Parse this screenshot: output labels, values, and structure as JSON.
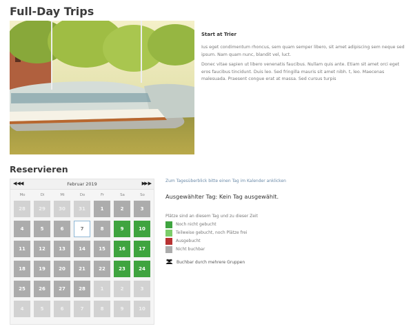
{
  "page": {
    "title": "Full-Day Trips"
  },
  "info": {
    "heading": "Start at Trier",
    "paragraphs": [
      "Ius eget condimentum rhoncus, sem quam semper libero, sit amet adipiscing sem neque sed ipsum. Nam quam nunc, blandit vel, luct.",
      "Donec vitae sapien ut libero venenatis faucibus. Nullam quis ante. Etiam sit amet orci eget eros faucibus tincidunt. Duis leo. Sed fringilla mauris sit amet nibh. t, leo. Maecenas malesuada. Praesent congue erat at massa. Sed cursus turpis"
    ]
  },
  "reserve": {
    "title": "Reservieren"
  },
  "calendar": {
    "month_label": "Februar 2019",
    "nav": {
      "prev_year": "◀◀",
      "prev_month": "◀",
      "next_month": "▶",
      "next_year": "▶▶"
    },
    "weekdays": [
      "Mo",
      "Di",
      "Mi",
      "Do",
      "Fr",
      "Sa",
      "So"
    ],
    "weeks": [
      [
        {
          "d": "28",
          "s": "outside"
        },
        {
          "d": "29",
          "s": "outside"
        },
        {
          "d": "30",
          "s": "outside"
        },
        {
          "d": "31",
          "s": "outside"
        },
        {
          "d": "1",
          "s": "unbookable"
        },
        {
          "d": "2",
          "s": "unbookable"
        },
        {
          "d": "3",
          "s": "unbookable"
        }
      ],
      [
        {
          "d": "4",
          "s": "unbookable"
        },
        {
          "d": "5",
          "s": "unbookable"
        },
        {
          "d": "6",
          "s": "unbookable"
        },
        {
          "d": "7",
          "s": "today"
        },
        {
          "d": "8",
          "s": "unbookable"
        },
        {
          "d": "9",
          "s": "free"
        },
        {
          "d": "10",
          "s": "free"
        }
      ],
      [
        {
          "d": "11",
          "s": "unbookable"
        },
        {
          "d": "12",
          "s": "unbookable"
        },
        {
          "d": "13",
          "s": "unbookable"
        },
        {
          "d": "14",
          "s": "unbookable"
        },
        {
          "d": "15",
          "s": "unbookable"
        },
        {
          "d": "16",
          "s": "free"
        },
        {
          "d": "17",
          "s": "free"
        }
      ],
      [
        {
          "d": "18",
          "s": "unbookable"
        },
        {
          "d": "19",
          "s": "unbookable"
        },
        {
          "d": "20",
          "s": "unbookable"
        },
        {
          "d": "21",
          "s": "unbookable"
        },
        {
          "d": "22",
          "s": "unbookable"
        },
        {
          "d": "23",
          "s": "free"
        },
        {
          "d": "24",
          "s": "free"
        }
      ],
      [
        {
          "d": "25",
          "s": "unbookable"
        },
        {
          "d": "26",
          "s": "unbookable"
        },
        {
          "d": "27",
          "s": "unbookable"
        },
        {
          "d": "28",
          "s": "unbookable"
        },
        {
          "d": "1",
          "s": "outside"
        },
        {
          "d": "2",
          "s": "outside"
        },
        {
          "d": "3",
          "s": "outside"
        }
      ],
      [
        {
          "d": "4",
          "s": "outside"
        },
        {
          "d": "5",
          "s": "outside"
        },
        {
          "d": "6",
          "s": "outside"
        },
        {
          "d": "7",
          "s": "outside"
        },
        {
          "d": "8",
          "s": "outside"
        },
        {
          "d": "9",
          "s": "outside"
        },
        {
          "d": "10",
          "s": "outside"
        }
      ]
    ]
  },
  "side": {
    "hint": "Zum Tagesüberblick bitte einen Tag im Kalender anklicken",
    "selected_day": "Ausgewählter Tag: Kein Tag ausgewählt.",
    "legend_title": "Plätze sind an diesem Tag und zu dieser Zeit",
    "legend": [
      {
        "label": "Noch nicht gebucht",
        "color": "#3fa43f"
      },
      {
        "label": "Teilweise gebucht, noch Plätze frei",
        "color": "#7ccd6a"
      },
      {
        "label": "Ausgebucht",
        "color": "#b83232"
      },
      {
        "label": "Nicht buchbar",
        "color": "#acacac"
      }
    ],
    "group_label": "Buchbar durch mehrere Gruppen"
  }
}
